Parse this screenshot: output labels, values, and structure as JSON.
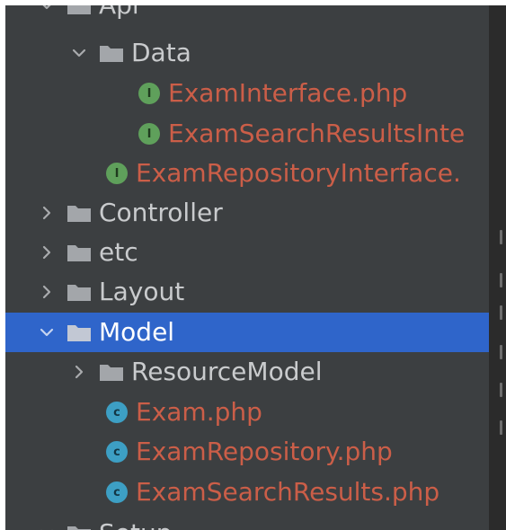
{
  "project_tree": {
    "items": [
      {
        "label": "Api",
        "kind": "folder",
        "expanded": true
      },
      {
        "label": "Data",
        "kind": "folder",
        "expanded": true
      },
      {
        "label": "ExamInterface.php",
        "kind": "interface-file"
      },
      {
        "label": "ExamSearchResultsInte",
        "kind": "interface-file"
      },
      {
        "label": "ExamRepositoryInterface.",
        "kind": "interface-file"
      },
      {
        "label": "Controller",
        "kind": "folder",
        "expanded": false
      },
      {
        "label": "etc",
        "kind": "folder",
        "expanded": false
      },
      {
        "label": "Layout",
        "kind": "folder",
        "expanded": false
      },
      {
        "label": "Model",
        "kind": "folder",
        "expanded": true,
        "selected": true
      },
      {
        "label": "ResourceModel",
        "kind": "folder",
        "expanded": false
      },
      {
        "label": "Exam.php",
        "kind": "class-file"
      },
      {
        "label": "ExamRepository.php",
        "kind": "class-file"
      },
      {
        "label": "ExamSearchResults.php",
        "kind": "class-file"
      },
      {
        "label": "Setup",
        "kind": "folder",
        "expanded": true
      }
    ],
    "badges": {
      "interface": "I",
      "class": "c"
    }
  },
  "colors": {
    "panel_background": "#3c3f41",
    "selection": "#2f65ca",
    "folder_text": "#c9cbcd",
    "file_text": "#cb5e48",
    "interface_badge": "#5fa05b",
    "class_badge": "#3d9fc4"
  }
}
